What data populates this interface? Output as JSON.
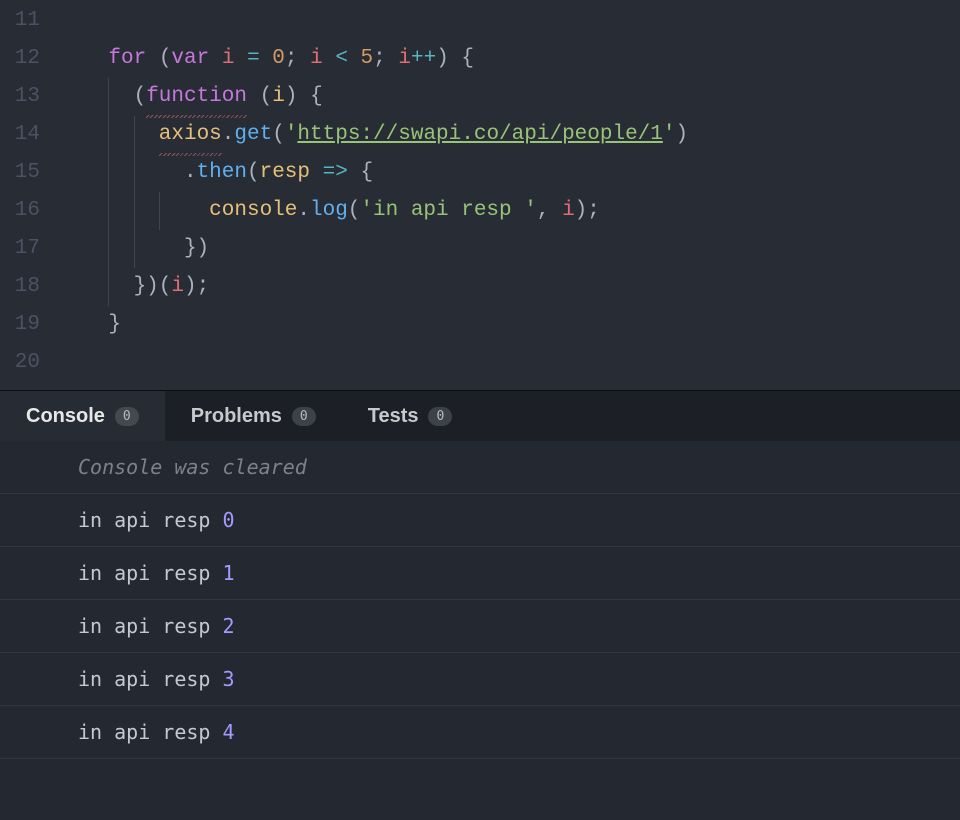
{
  "editor": {
    "lines": [
      {
        "num": "11",
        "tokens": []
      },
      {
        "num": "12",
        "tokens": [
          {
            "t": "indent",
            "w": 4
          },
          {
            "t": "keyword",
            "v": "for"
          },
          {
            "t": "sp",
            "v": " "
          },
          {
            "t": "punct",
            "v": "("
          },
          {
            "t": "keyword",
            "v": "var"
          },
          {
            "t": "sp",
            "v": " "
          },
          {
            "t": "var",
            "v": "i"
          },
          {
            "t": "sp",
            "v": " "
          },
          {
            "t": "op",
            "v": "="
          },
          {
            "t": "sp",
            "v": " "
          },
          {
            "t": "num",
            "v": "0"
          },
          {
            "t": "punct",
            "v": ";"
          },
          {
            "t": "sp",
            "v": " "
          },
          {
            "t": "var",
            "v": "i"
          },
          {
            "t": "sp",
            "v": " "
          },
          {
            "t": "op",
            "v": "<"
          },
          {
            "t": "sp",
            "v": " "
          },
          {
            "t": "num",
            "v": "5"
          },
          {
            "t": "punct",
            "v": ";"
          },
          {
            "t": "sp",
            "v": " "
          },
          {
            "t": "var",
            "v": "i"
          },
          {
            "t": "op",
            "v": "++"
          },
          {
            "t": "punct",
            "v": ")"
          },
          {
            "t": "sp",
            "v": " "
          },
          {
            "t": "punct",
            "v": "{"
          }
        ]
      },
      {
        "num": "13",
        "tokens": [
          {
            "t": "indent",
            "w": 4
          },
          {
            "t": "guide",
            "w": 2
          },
          {
            "t": "punct",
            "v": "("
          },
          {
            "t": "keyword",
            "v": "function",
            "squiggle": true
          },
          {
            "t": "sp",
            "v": " "
          },
          {
            "t": "punct",
            "v": "("
          },
          {
            "t": "param",
            "v": "i"
          },
          {
            "t": "punct",
            "v": ")"
          },
          {
            "t": "sp",
            "v": " "
          },
          {
            "t": "punct",
            "v": "{"
          }
        ]
      },
      {
        "num": "14",
        "tokens": [
          {
            "t": "indent",
            "w": 4
          },
          {
            "t": "guide",
            "w": 2
          },
          {
            "t": "guide",
            "w": 2
          },
          {
            "t": "obj",
            "v": "axios",
            "squiggle": true
          },
          {
            "t": "punct",
            "v": "."
          },
          {
            "t": "func",
            "v": "get"
          },
          {
            "t": "punct",
            "v": "("
          },
          {
            "t": "str",
            "v": "'"
          },
          {
            "t": "url",
            "v": "https://swapi.co/api/people/1"
          },
          {
            "t": "str",
            "v": "'"
          },
          {
            "t": "punct",
            "v": ")"
          }
        ]
      },
      {
        "num": "15",
        "tokens": [
          {
            "t": "indent",
            "w": 4
          },
          {
            "t": "guide",
            "w": 2
          },
          {
            "t": "guide",
            "w": 2
          },
          {
            "t": "indent",
            "w": 2
          },
          {
            "t": "punct",
            "v": "."
          },
          {
            "t": "func",
            "v": "then"
          },
          {
            "t": "punct",
            "v": "("
          },
          {
            "t": "param",
            "v": "resp"
          },
          {
            "t": "sp",
            "v": " "
          },
          {
            "t": "op",
            "v": "=>"
          },
          {
            "t": "sp",
            "v": " "
          },
          {
            "t": "punct",
            "v": "{"
          }
        ]
      },
      {
        "num": "16",
        "tokens": [
          {
            "t": "indent",
            "w": 4
          },
          {
            "t": "guide",
            "w": 2
          },
          {
            "t": "guide",
            "w": 2
          },
          {
            "t": "guide",
            "w": 4
          },
          {
            "t": "obj",
            "v": "console"
          },
          {
            "t": "punct",
            "v": "."
          },
          {
            "t": "func",
            "v": "log"
          },
          {
            "t": "punct",
            "v": "("
          },
          {
            "t": "str",
            "v": "'in api resp '"
          },
          {
            "t": "punct",
            "v": ","
          },
          {
            "t": "sp",
            "v": " "
          },
          {
            "t": "var",
            "v": "i"
          },
          {
            "t": "punct",
            "v": ")"
          },
          {
            "t": "punct",
            "v": ";"
          }
        ]
      },
      {
        "num": "17",
        "tokens": [
          {
            "t": "indent",
            "w": 4
          },
          {
            "t": "guide",
            "w": 2
          },
          {
            "t": "guide",
            "w": 2
          },
          {
            "t": "indent",
            "w": 2
          },
          {
            "t": "punct",
            "v": "})"
          }
        ]
      },
      {
        "num": "18",
        "tokens": [
          {
            "t": "indent",
            "w": 4
          },
          {
            "t": "guide",
            "w": 2
          },
          {
            "t": "punct",
            "v": "})("
          },
          {
            "t": "var",
            "v": "i"
          },
          {
            "t": "punct",
            "v": ");"
          }
        ]
      },
      {
        "num": "19",
        "tokens": [
          {
            "t": "indent",
            "w": 4
          },
          {
            "t": "punct",
            "v": "}"
          }
        ]
      },
      {
        "num": "20",
        "tokens": []
      }
    ]
  },
  "panel": {
    "tabs": [
      {
        "label": "Console",
        "count": "0",
        "active": true
      },
      {
        "label": "Problems",
        "count": "0",
        "active": false
      },
      {
        "label": "Tests",
        "count": "0",
        "active": false
      }
    ]
  },
  "console": {
    "cleared_text": "Console was cleared",
    "rows": [
      {
        "text": "in api resp ",
        "num": "0"
      },
      {
        "text": "in api resp ",
        "num": "1"
      },
      {
        "text": "in api resp ",
        "num": "2"
      },
      {
        "text": "in api resp ",
        "num": "3"
      },
      {
        "text": "in api resp ",
        "num": "4"
      }
    ]
  }
}
